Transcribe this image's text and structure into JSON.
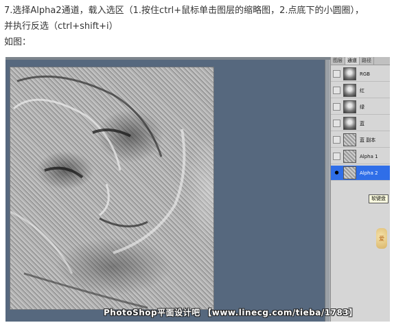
{
  "instructions": {
    "line1": "7.选择Alpha2通道，载入选区（1.按住ctrl+鼠标单击图层的缩略图，2.点底下的小圆圈），",
    "line2": "并执行反选（ctrl+shift+i）",
    "line3": "如图："
  },
  "panel": {
    "tabs": [
      "图层",
      "通道",
      "路径"
    ],
    "active_tab": 1,
    "channels": [
      {
        "name": "RGB",
        "selected": false,
        "visible": false
      },
      {
        "name": "红",
        "selected": false,
        "visible": false
      },
      {
        "name": "绿",
        "selected": false,
        "visible": false
      },
      {
        "name": "蓝",
        "selected": false,
        "visible": false
      },
      {
        "name": "蓝 副本",
        "selected": false,
        "visible": false
      },
      {
        "name": "Alpha 1",
        "selected": false,
        "visible": false
      },
      {
        "name": "Alpha 2",
        "selected": true,
        "visible": true
      }
    ]
  },
  "tooltip": "软键盘",
  "watermark": "PhotoShop平面设计吧 【www.linecg.com/tieba/1783】",
  "badge": "爱",
  "colors": {
    "canvas_bg": "#56687e",
    "selected_row": "#2f6ee8",
    "panel_bg": "#d6d6d6"
  },
  "icons": {
    "eye": "eye-icon"
  }
}
